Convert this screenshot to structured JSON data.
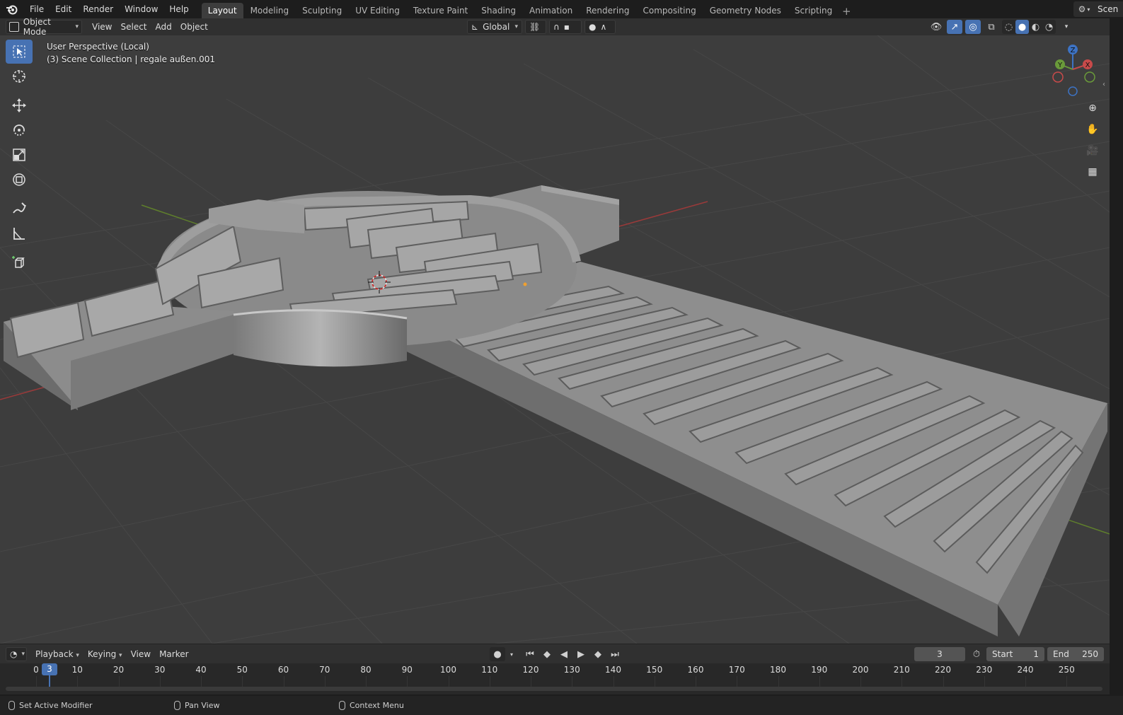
{
  "topbar": {
    "menus": [
      "File",
      "Edit",
      "Render",
      "Window",
      "Help"
    ],
    "workspaces": [
      "Layout",
      "Modeling",
      "Sculpting",
      "UV Editing",
      "Texture Paint",
      "Shading",
      "Animation",
      "Rendering",
      "Compositing",
      "Geometry Nodes",
      "Scripting"
    ],
    "active_workspace": "Layout",
    "scene_name": "Scen"
  },
  "viewport_header": {
    "mode": "Object Mode",
    "menus": [
      "View",
      "Select",
      "Add",
      "Object"
    ],
    "transform_orientation": "Global"
  },
  "viewport": {
    "perspective_label": "User Perspective (Local)",
    "collection_label": "(3) Scene Collection | regale außen.001",
    "gizmo_axes": [
      "Z",
      "Y",
      "X"
    ],
    "colors": {
      "background": "#3d3d3d",
      "grid": "#4a4a4a",
      "x_axis": "#a33a3a",
      "y_axis": "#6a8f2f",
      "model": "#8f8f8f",
      "selected_accent": "#4772b3"
    }
  },
  "timeline": {
    "menus": [
      "Playback",
      "Keying",
      "View",
      "Marker"
    ],
    "current_frame": "3",
    "start_label": "Start",
    "start_value": "1",
    "end_label": "End",
    "end_value": "250",
    "ticks": [
      "0",
      "10",
      "20",
      "30",
      "40",
      "50",
      "60",
      "70",
      "80",
      "90",
      "100",
      "110",
      "120",
      "130",
      "140",
      "150",
      "160",
      "170",
      "180",
      "190",
      "200",
      "210",
      "220",
      "230",
      "240",
      "250"
    ]
  },
  "statusbar": {
    "left_action": "Set Active Modifier",
    "middle_action": "Pan View",
    "right_action": "Context Menu"
  }
}
